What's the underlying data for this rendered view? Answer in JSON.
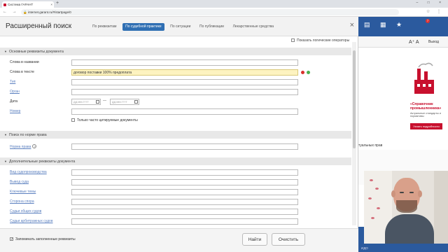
{
  "browser": {
    "tab_title": "Система ГАРАНТ",
    "tab_close": "×",
    "new_tab": "+",
    "url": "internet.garant.ru/#/startpage/0",
    "nav": "← → ⟳"
  },
  "modal": {
    "title": "Расширенный поиск",
    "close": "×",
    "tabs": [
      {
        "label": "По реквизитам",
        "active": false
      },
      {
        "label": "По судебной практике",
        "active": true
      },
      {
        "label": "По ситуации",
        "active": false
      },
      {
        "label": "По публикации",
        "active": false
      },
      {
        "label": "Лекарственные средства",
        "active": false
      }
    ],
    "show_logic_label": "Показать логические операторы",
    "sections": {
      "basic": "Основные реквизиты документа",
      "norm": "Поиск по норме права",
      "additional": "Дополнительные реквизиты документа"
    },
    "basic_fields": {
      "name_label": "Слова в названии",
      "text_label": "Слова в тексте",
      "text_value": "договор поставки 100% предоплата",
      "type_label": "Тип",
      "organ_label": "Орган",
      "date_label": "Дата",
      "date_from_placeholder": "ДД.ММ.ГГГГ",
      "date_to_placeholder": "ДД.ММ.ГГГГ",
      "date_dash": "—",
      "number_label": "Номер",
      "cited_only_label": "Только часто цитируемые документы"
    },
    "norm_fields": {
      "norm_label": "Норма права",
      "help": "?"
    },
    "additional_fields": {
      "labels": [
        "Вид судопроизводства",
        "Вывод суда",
        "Ключевые темы",
        "Сторона спора",
        "Судьи общих судов",
        "Судьи арбитражных судов"
      ]
    },
    "footer": {
      "remember_label": "Запоминать заполненные реквизиты",
      "find_label": "Найти",
      "clear_label": "Очистить"
    }
  },
  "site": {
    "exit_label": "Выход",
    "font_control": "A⁺ A",
    "badge": "7",
    "ad_title": "«Справочник промышленника»",
    "ad_sub": "Актуальные стандарты и нормативы",
    "ad_button": "Узнать подробности",
    "partial_text": "туальных прав",
    "footer_link": "ИДО"
  },
  "colors": {
    "accent": "#2f6fb3",
    "highlight": "#fdf3c0",
    "error_dot": "#d9302c",
    "ok_dot": "#4caf50",
    "brand_red": "#c8102e"
  }
}
